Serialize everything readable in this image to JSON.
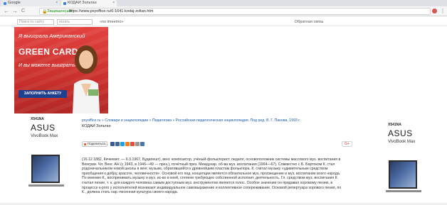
{
  "browser": {
    "tabs": [
      {
        "label": "Google",
        "favicon_color": "#4285f4",
        "active": false
      },
      {
        "label": "КОДАИ Зольтан",
        "favicon_color": "#3b7dd8",
        "active": true
      }
    ],
    "nav": {
      "back": "←",
      "forward": "→",
      "reload": "C"
    },
    "omnibox": {
      "secure_label": "Защищенный",
      "url": "https://www.psyoffice.ru/6-1641-kodaj-zoltan.htm"
    },
    "menu": "⋮"
  },
  "site": {
    "search_placeholder": "Поиск по сайту",
    "search2_placeholder": "искать",
    "nav_link": "«no imeemo»",
    "feedback": "Обратная связь"
  },
  "ad": {
    "line1": "Я выиграла Американский",
    "headline": "GREEN CARD",
    "line3": "И вы можете выиграть",
    "cta": "ЗАПОЛНИТЬ АНКЕТУ",
    "colors": {
      "background": "#d63a36",
      "cta": "#1f3f8f"
    }
  },
  "side_ads": [
    {
      "model": "X541NA",
      "brand": "ASUS",
      "product": "VivoBook Max"
    },
    {
      "model": "X541NA",
      "brand": "ASUS",
      "product": "VivoBook Max"
    }
  ],
  "article": {
    "breadcrumbs": "psyoffice.ru » Словари и энциклопедии » Педагогика » Российская педагогическая энциклопедия. Под ред. В. Г. Панова, 1993 г.",
    "title": "КОДАИ Зольтан",
    "share_label": "Поделиться…",
    "social_colors": [
      "#3b5998",
      "#45668e",
      "#1da1f2",
      "#f58220",
      "#e74c3c",
      "#999999",
      "#4a76a8"
    ],
    "gplus": "G+",
    "body": "(16.12.1882, Кечкемет, — 6.3.1967, Будапешт), венг. композитор, учёный-фольклорист, педагог, основоположник системы массового муз. воспитания в Венгрии. Чл. Венг. АН (с 1943, в 1946—49 — през.), почётный през. Междунар. об-ва муз. воспитания (1964—67). Совместно с Б. Бартоком К. стал родоначальником новой школы в венг. музыке, обратившейся к древнейшим пластам фольклора. К. считал музыку «удивительным средством приобщения к добру, красоте, человечности». Основой его пед. концепции является обязательное муз. просвещение и муз. воспитание всего народа. По мнению К., воспринимать музыку и муз. ис-во в кней, степени требующее собственной исполнит. деятельность. Гл. средством муз. воспитания К. считал пение, т. к. для каждого человека самым доступным муз. инструментом является голос. Особое значение он придавал хоровому пению, в процессе к-рого у исполнителей возникают индивидуальное самовыражение и коллективное сопереживание. Основой репертуара хорового пения, по К., должна стать нар.-песенная культура своего народа."
  }
}
